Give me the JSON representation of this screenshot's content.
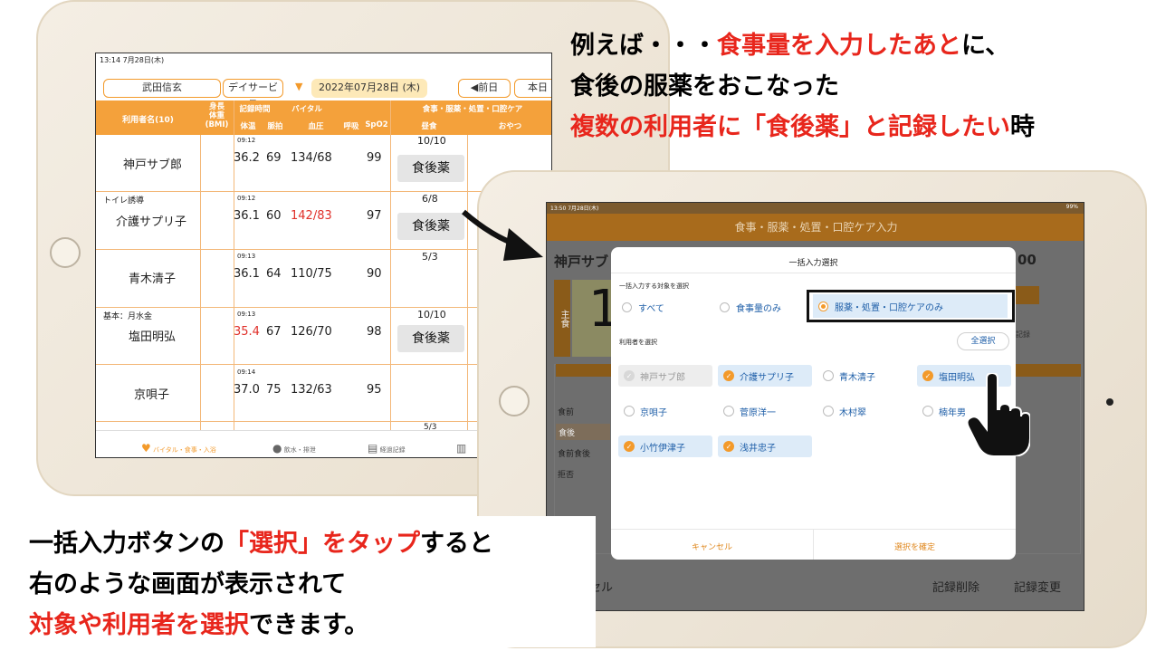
{
  "caption_top": {
    "line1_a": "例えば・・・",
    "line1_b": "食事量を入力したあと",
    "line1_c": "に、",
    "line2": "食後の服薬をおこなった",
    "line3_a": "複数の利用者に「食後薬」と記録したい",
    "line3_b": "時"
  },
  "caption_bottom": {
    "line1_a": "一括入力ボタンの",
    "line1_b": "「選択」をタップ",
    "line1_c": "すると",
    "line2": "右のような画面が表示されて",
    "line3_a": "対象や利用者を選択",
    "line3_b": "できます。"
  },
  "tablet1": {
    "status_time": "13:14  7月28日(木)",
    "staff": "武田信玄",
    "service": "デイサービス",
    "date": "2022年07月28日 (木)",
    "prev_btn": "◀前日",
    "today_btn": "本日",
    "headers": {
      "user": "利用者名(10)",
      "height_weight": "身長\n体重\n(BMI)",
      "record_time": "記録時間",
      "vital": "バイタル",
      "temp": "体温",
      "pulse": "脈拍",
      "bp": "血圧",
      "resp": "呼吸",
      "spo2": "SpO2",
      "meal_group": "食事・服薬・処置・口腔ケア",
      "lunch": "昼食",
      "snack": "おやつ"
    },
    "rows": [
      {
        "note": "",
        "name": "神戸サブ郎",
        "time": "09:12",
        "temp": "36.2",
        "pulse": "69",
        "bp": "134/68",
        "spo2": "99",
        "meal": "10/10",
        "med": "食後薬"
      },
      {
        "note": "トイレ誘導",
        "name": "介護サプリ子",
        "time": "09:12",
        "temp": "36.1",
        "pulse": "60",
        "bp": "142/83",
        "spo2": "97",
        "meal": "6/8",
        "med": "食後薬"
      },
      {
        "note": "",
        "name": "青木清子",
        "time": "09:13",
        "temp": "36.1",
        "pulse": "64",
        "bp": "110/75",
        "spo2": "90",
        "meal": "5/3",
        "med": ""
      },
      {
        "note": "基本：月水金",
        "name": "塩田明弘",
        "time": "09:13",
        "temp": "35.4",
        "pulse": "67",
        "bp": "126/70",
        "spo2": "98",
        "meal": "10/10",
        "med": "食後薬"
      },
      {
        "note": "",
        "name": "京唄子",
        "time": "09:14",
        "temp": "37.0",
        "pulse": "75",
        "bp": "132/63",
        "spo2": "95",
        "meal": "",
        "med": ""
      }
    ],
    "partial_meal": "5/3",
    "footer": {
      "vital": "バイタル・食事・入浴",
      "water": "飲水・排泄",
      "progress": "経過記録"
    }
  },
  "tablet2": {
    "status_time": "13:50  7月28日(木)",
    "status_right": "99%",
    "title": "食事・服薬・処置・口腔ケア入力",
    "bg_name": "神戸サブ",
    "bg_num": "00",
    "bg_big": "1",
    "bg_side": "主食",
    "bg_list": [
      "食前",
      "食後",
      "食前食後",
      "拒否"
    ],
    "bg_record": "記録",
    "bottom": {
      "cancel": "ンセル",
      "delete": "記録削除",
      "change": "記録変更"
    },
    "modal": {
      "title": "一括入力選択",
      "target_label": "一括入力する対象を選択",
      "targets": [
        "すべて",
        "食事量のみ",
        "服薬・処置・口腔ケアのみ"
      ],
      "selected_target": "服薬・処置・口腔ケアのみ",
      "user_label": "利用者を選択",
      "select_all": "全選択",
      "users": [
        {
          "name": "神戸サブ郎",
          "state": "disabled"
        },
        {
          "name": "介護サプリ子",
          "state": "checked"
        },
        {
          "name": "青木清子",
          "state": "unchecked"
        },
        {
          "name": "塩田明弘",
          "state": "checked"
        },
        {
          "name": "京唄子",
          "state": "unchecked"
        },
        {
          "name": "菅原洋一",
          "state": "unchecked"
        },
        {
          "name": "木村翠",
          "state": "unchecked"
        },
        {
          "name": "楠年男",
          "state": "unchecked"
        },
        {
          "name": "小竹伊津子",
          "state": "checked"
        },
        {
          "name": "浅井忠子",
          "state": "checked"
        }
      ],
      "cancel": "キャンセル",
      "confirm": "選択を確定"
    }
  },
  "colors": {
    "accent": "#f39a2b",
    "highlight_red": "#e8261c",
    "link_blue": "#1f5fa8"
  }
}
